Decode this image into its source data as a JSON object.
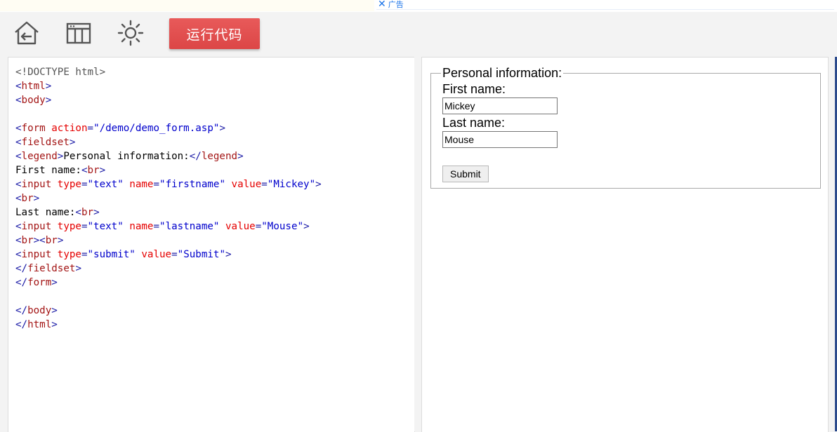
{
  "ad": {
    "label": "广告",
    "close_glyph": "✕"
  },
  "toolbar": {
    "run_label": "运行代码",
    "icons": [
      "home-back-icon",
      "layout-icon",
      "brightness-icon"
    ]
  },
  "code_lines": [
    [
      [
        "dt",
        "<!DOCTYPE html>"
      ]
    ],
    [
      [
        "tag",
        "<"
      ],
      [
        "tn",
        "html"
      ],
      [
        "tag",
        ">"
      ]
    ],
    [
      [
        "tag",
        "<"
      ],
      [
        "tn",
        "body"
      ],
      [
        "tag",
        ">"
      ]
    ],
    [],
    [
      [
        "tag",
        "<"
      ],
      [
        "tn",
        "form "
      ],
      [
        "an",
        "action"
      ],
      [
        "tag",
        "="
      ],
      [
        "av",
        "\"/demo/demo_form.asp\""
      ],
      [
        "tag",
        ">"
      ]
    ],
    [
      [
        "tag",
        "<"
      ],
      [
        "tn",
        "fieldset"
      ],
      [
        "tag",
        ">"
      ]
    ],
    [
      [
        "tag",
        "<"
      ],
      [
        "tn",
        "legend"
      ],
      [
        "tag",
        ">"
      ],
      [
        "txt",
        "Personal information:"
      ],
      [
        "tag",
        "</"
      ],
      [
        "tn",
        "legend"
      ],
      [
        "tag",
        ">"
      ]
    ],
    [
      [
        "txt",
        "First name:"
      ],
      [
        "tag",
        "<"
      ],
      [
        "tn",
        "br"
      ],
      [
        "tag",
        ">"
      ]
    ],
    [
      [
        "tag",
        "<"
      ],
      [
        "tn",
        "input "
      ],
      [
        "an",
        "type"
      ],
      [
        "tag",
        "="
      ],
      [
        "av",
        "\"text\" "
      ],
      [
        "an",
        "name"
      ],
      [
        "tag",
        "="
      ],
      [
        "av",
        "\"firstname\" "
      ],
      [
        "an",
        "value"
      ],
      [
        "tag",
        "="
      ],
      [
        "av",
        "\"Mickey\""
      ],
      [
        "tag",
        ">"
      ]
    ],
    [
      [
        "tag",
        "<"
      ],
      [
        "tn",
        "br"
      ],
      [
        "tag",
        ">"
      ]
    ],
    [
      [
        "txt",
        "Last name:"
      ],
      [
        "tag",
        "<"
      ],
      [
        "tn",
        "br"
      ],
      [
        "tag",
        ">"
      ]
    ],
    [
      [
        "tag",
        "<"
      ],
      [
        "tn",
        "input "
      ],
      [
        "an",
        "type"
      ],
      [
        "tag",
        "="
      ],
      [
        "av",
        "\"text\" "
      ],
      [
        "an",
        "name"
      ],
      [
        "tag",
        "="
      ],
      [
        "av",
        "\"lastname\" "
      ],
      [
        "an",
        "value"
      ],
      [
        "tag",
        "="
      ],
      [
        "av",
        "\"Mouse\""
      ],
      [
        "tag",
        ">"
      ]
    ],
    [
      [
        "tag",
        "<"
      ],
      [
        "tn",
        "br"
      ],
      [
        "tag",
        "><"
      ],
      [
        "tn",
        "br"
      ],
      [
        "tag",
        ">"
      ]
    ],
    [
      [
        "tag",
        "<"
      ],
      [
        "tn",
        "input "
      ],
      [
        "an",
        "type"
      ],
      [
        "tag",
        "="
      ],
      [
        "av",
        "\"submit\" "
      ],
      [
        "an",
        "value"
      ],
      [
        "tag",
        "="
      ],
      [
        "av",
        "\"Submit\""
      ],
      [
        "tag",
        ">"
      ]
    ],
    [
      [
        "tag",
        "</"
      ],
      [
        "tn",
        "fieldset"
      ],
      [
        "tag",
        ">"
      ]
    ],
    [
      [
        "tag",
        "</"
      ],
      [
        "tn",
        "form"
      ],
      [
        "tag",
        ">"
      ]
    ],
    [],
    [
      [
        "tag",
        "</"
      ],
      [
        "tn",
        "body"
      ],
      [
        "tag",
        ">"
      ]
    ],
    [
      [
        "tag",
        "</"
      ],
      [
        "tn",
        "html"
      ],
      [
        "tag",
        ">"
      ]
    ]
  ],
  "preview": {
    "legend": "Personal information:",
    "first_label": "First name:",
    "first_value": "Mickey",
    "last_label": "Last name:",
    "last_value": "Mouse",
    "submit_label": "Submit"
  }
}
